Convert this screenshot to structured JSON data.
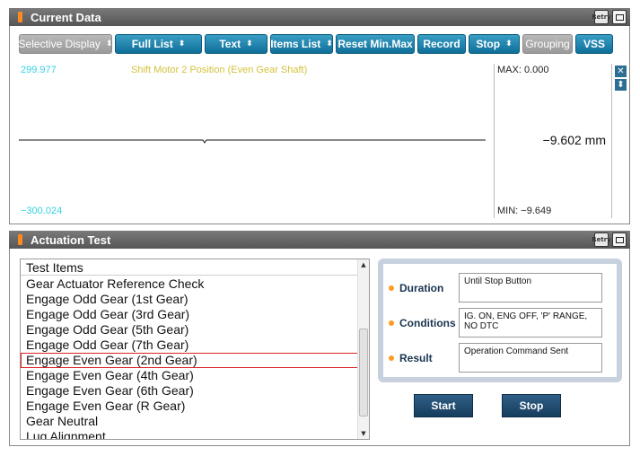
{
  "current_data": {
    "title": "Current Data",
    "toolbar": {
      "selective_display": "Selective Display",
      "full_list": "Full List",
      "text": "Text",
      "items_list": "Items List",
      "reset_minmax": "Reset Min.Max",
      "record": "Record",
      "stop": "Stop",
      "grouping": "Grouping",
      "vss": "VSS"
    },
    "graph": {
      "scale_max": "299.977",
      "scale_min": "−300.024",
      "series_name": "Shift Motor 2 Position (Even Gear Shaft)",
      "max_readout": "MAX: 0.000",
      "min_readout": "MIN: −9.649",
      "current_value": "−9.602 mm"
    },
    "retry_icon_text": "Retry"
  },
  "actuation_test": {
    "title": "Actuation Test",
    "list_header": "Test Items",
    "items": [
      "Gear Actuator Reference Check",
      "Engage Odd Gear (1st Gear)",
      "Engage Odd Gear (3rd Gear)",
      "Engage Odd Gear (5th Gear)",
      "Engage Odd Gear (7th Gear)",
      "Engage Even Gear (2nd Gear)",
      "Engage Even Gear (4th Gear)",
      "Engage Even Gear (6th Gear)",
      "Engage Even Gear (R Gear)",
      "Gear Neutral",
      "Lug Alignment"
    ],
    "selected_index": 5,
    "info": {
      "duration_label": "Duration",
      "duration_value": "Until Stop Button",
      "conditions_label": "Conditions",
      "conditions_value": "IG. ON, ENG OFF, 'P' RANGE, NO DTC",
      "result_label": "Result",
      "result_value": "Operation Command Sent"
    },
    "start_label": "Start",
    "stop_label": "Stop"
  },
  "colors": {
    "header_bg": "#666666",
    "accent_orange": "#ff8a1f",
    "toolbar_blue": "#1a83b0",
    "scale_cyan": "#35d0e0",
    "series_yellow": "#d4c23c",
    "selected_outline": "#dd2222"
  }
}
